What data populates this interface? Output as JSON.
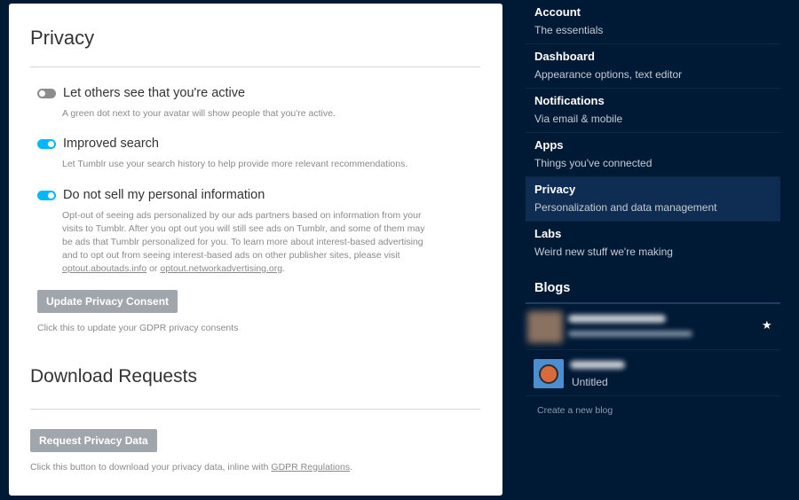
{
  "privacy": {
    "title": "Privacy",
    "settings": [
      {
        "title": "Let others see that you're active",
        "description": "A green dot next to your avatar will show people that you're active.",
        "enabled": false
      },
      {
        "title": "Improved search",
        "description": "Let Tumblr use your search history to help provide more relevant recommendations.",
        "enabled": true
      },
      {
        "title": "Do not sell my personal information",
        "description": "Opt-out of seeing ads personalized by our ads partners based on information from your visits to Tumblr. After you opt out you will still see ads on Tumblr, and some of them may be ads that Tumblr personalized for you. To learn more about interest-based advertising and to opt out from seeing interest-based ads on other publisher sites, please visit",
        "link1": "optout.aboutads.info",
        "or_text": "or",
        "link2": "optout.networkadvertising.org",
        "end_text": ".",
        "enabled": true
      }
    ],
    "consent_button": "Update Privacy Consent",
    "consent_note": "Click this to update your GDPR privacy consents"
  },
  "download": {
    "title": "Download Requests",
    "button": "Request Privacy Data",
    "note": "Click this button to download your privacy data, inline with",
    "note_link": "GDPR Regulations",
    "note_end": "."
  },
  "sidebar": {
    "items": [
      {
        "title": "Account",
        "subtitle": "The essentials"
      },
      {
        "title": "Dashboard",
        "subtitle": "Appearance options, text editor"
      },
      {
        "title": "Notifications",
        "subtitle": "Via email & mobile"
      },
      {
        "title": "Apps",
        "subtitle": "Things you've connected"
      },
      {
        "title": "Privacy",
        "subtitle": "Personalization and data management"
      },
      {
        "title": "Labs",
        "subtitle": "Weird new stuff we're making"
      }
    ],
    "active_index": 4,
    "blogs_heading": "Blogs",
    "blog2_name": "Untitled",
    "create_blog": "Create a new blog",
    "star_glyph": "★"
  },
  "colors": {
    "background": "#001935",
    "toggle_on": "#00b8ff",
    "toggle_off": "#8c8c8c",
    "button": "#a1a6ad",
    "active_nav": "#0f2d52"
  }
}
